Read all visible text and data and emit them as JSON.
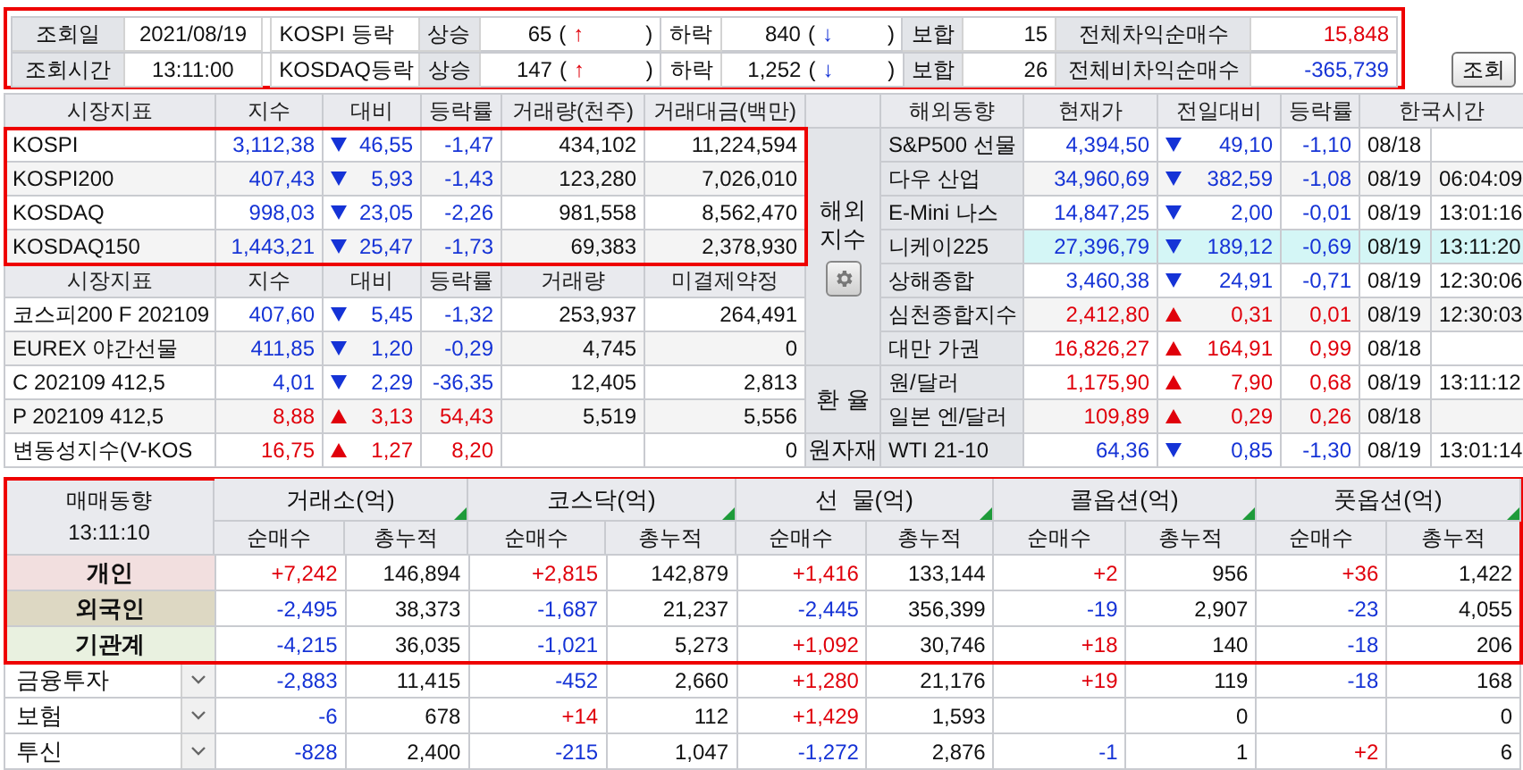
{
  "summary": {
    "highlighted": true,
    "info": [
      {
        "label": "조회일",
        "value": "2021/08/19"
      },
      {
        "label": "조회시간",
        "value": "13:11:00"
      }
    ],
    "markets": [
      {
        "name": "KOSPI 등락",
        "up_label": "상승",
        "up_count": "65",
        "up_open": "(",
        "up_arrow": "↑",
        "up_close": ")",
        "down_label": "하락",
        "down_count": "840",
        "down_open": "(",
        "down_arrow": "↓",
        "down_close": ")",
        "flat_label": "보합",
        "flat_count": "15",
        "program_label": "전체차익순매수",
        "program_value": "15,848",
        "program_rising": true
      },
      {
        "name": "KOSDAQ등락",
        "up_label": "상승",
        "up_count": "147",
        "up_open": "(",
        "up_arrow": "↑",
        "up_close": ")",
        "down_label": "하락",
        "down_count": "1,252",
        "down_open": "(",
        "down_arrow": "↓",
        "down_close": ")",
        "flat_label": "보합",
        "flat_count": "26",
        "program_label": "전체비차익순매수",
        "program_value": "-365,739",
        "program_rising": false
      }
    ]
  },
  "query_button": "조회",
  "domestic_indices": {
    "highlighted": true,
    "columns": [
      "시장지표",
      "지수",
      "대비",
      "등락률",
      "거래량(천주)",
      "거래대금(백만)"
    ],
    "rows": [
      {
        "name": "KOSPI",
        "index": "3,112,38",
        "rising": false,
        "change": "46,55",
        "rate": "-1,47",
        "volume": "434,102",
        "amount": "11,224,594"
      },
      {
        "name": "KOSPI200",
        "index": "407,43",
        "rising": false,
        "change": "5,93",
        "rate": "-1,43",
        "volume": "123,280",
        "amount": "7,026,010"
      },
      {
        "name": "KOSDAQ",
        "index": "998,03",
        "rising": false,
        "change": "23,05",
        "rate": "-2,26",
        "volume": "981,558",
        "amount": "8,562,470"
      },
      {
        "name": "KOSDAQ150",
        "index": "1,443,21",
        "rising": false,
        "change": "25,47",
        "rate": "-1,73",
        "volume": "69,383",
        "amount": "2,378,930"
      }
    ]
  },
  "derivatives": {
    "columns": [
      "시장지표",
      "지수",
      "대비",
      "등락률",
      "거래량",
      "미결제약정"
    ],
    "rows": [
      {
        "name": "코스피200 F 202109",
        "index": "407,60",
        "rising": false,
        "change": "5,45",
        "rate": "-1,32",
        "volume": "253,937",
        "amount": "264,491"
      },
      {
        "name": "EUREX 야간선물",
        "index": "411,85",
        "rising": false,
        "change": "1,20",
        "rate": "-0,29",
        "volume": "4,745",
        "amount": "0"
      },
      {
        "name": "C 202109 412,5",
        "index": "4,01",
        "rising": false,
        "change": "2,29",
        "rate": "-36,35",
        "volume": "12,405",
        "amount": "2,813"
      },
      {
        "name": "P 202109 412,5",
        "index": "8,88",
        "rising": true,
        "change": "3,13",
        "rate": "54,43",
        "volume": "5,519",
        "amount": "5,556"
      },
      {
        "name": "변동성지수(V-KOS",
        "index": "16,75",
        "rising": true,
        "change": "1,27",
        "rate": "8,20",
        "amount": "0"
      }
    ]
  },
  "overseas": {
    "columns": [
      "해외동향",
      "현재가",
      "전일대비",
      "등락률",
      "한국시간"
    ],
    "groups": [
      {
        "label": "해외지수",
        "has_settings": true,
        "rows": [
          {
            "name": "S&P500 선물",
            "price": "4,394,50",
            "rising": false,
            "change": "49,10",
            "rate": "-1,10",
            "date": "08/18",
            "selected": false
          },
          {
            "name": "다우 산업",
            "price": "34,960,69",
            "rising": false,
            "change": "382,59",
            "rate": "-1,08",
            "date": "08/19",
            "time": "06:04:09",
            "selected": false
          },
          {
            "name": "E-Mini 나스",
            "price": "14,847,25",
            "rising": false,
            "change": "2,00",
            "rate": "-0,01",
            "date": "08/19",
            "time": "13:01:16",
            "selected": false
          },
          {
            "name": "니케이225",
            "price": "27,396,79",
            "rising": false,
            "change": "189,12",
            "rate": "-0,69",
            "date": "08/19",
            "time": "13:11:20",
            "selected": true
          },
          {
            "name": "상해종합",
            "price": "3,460,38",
            "rising": false,
            "change": "24,91",
            "rate": "-0,71",
            "date": "08/19",
            "time": "12:30:06",
            "selected": false
          },
          {
            "name": "심천종합지수",
            "price": "2,412,80",
            "rising": true,
            "change": "0,31",
            "rate": "0,01",
            "date": "08/19",
            "time": "12:30:03",
            "selected": false
          },
          {
            "name": "대만 가권",
            "price": "16,826,27",
            "rising": true,
            "change": "164,91",
            "rate": "0,99",
            "date": "08/18",
            "selected": false
          }
        ]
      },
      {
        "label": "환 율",
        "has_settings": false,
        "rows": [
          {
            "name": "원/달러",
            "price": "1,175,90",
            "rising": true,
            "change": "7,90",
            "rate": "0,68",
            "date": "08/19",
            "time": "13:11:12",
            "selected": false
          },
          {
            "name": "일본 엔/달러",
            "price": "109,89",
            "rising": true,
            "change": "0,29",
            "rate": "0,26",
            "date": "08/18",
            "selected": false
          }
        ]
      },
      {
        "label": "원자재",
        "has_settings": false,
        "rows": [
          {
            "name": "WTI 21-10",
            "price": "64,36",
            "rising": false,
            "change": "0,85",
            "rate": "-1,30",
            "date": "08/19",
            "time": "13:01:14",
            "selected": false
          }
        ]
      }
    ]
  },
  "trading": {
    "highlighted": true,
    "title": "매매동향",
    "time": "13:11:10",
    "groups": [
      "거래소(억)",
      "코스닥(억)",
      "선  물(억)",
      "콜옵션(억)",
      "풋옵션(억)"
    ],
    "subcolumns": [
      "순매수",
      "총누적",
      "순매수",
      "총누적",
      "순매수",
      "총누적",
      "순매수",
      "총누적",
      "순매수",
      "총누적"
    ],
    "rows": [
      {
        "label": "개인",
        "kind": "investor",
        "color": "#f2dfdf",
        "cells": [
          {
            "net": "+7,242",
            "rising": true,
            "total": "146,894"
          },
          {
            "net": "+2,815",
            "rising": true,
            "total": "142,879"
          },
          {
            "net": "+1,416",
            "rising": true,
            "total": "133,144"
          },
          {
            "net": "+2",
            "rising": true,
            "total": "956"
          },
          {
            "net": "+36",
            "rising": true,
            "total": "1,422"
          }
        ]
      },
      {
        "label": "외국인",
        "kind": "investor",
        "color": "#ddd8c3",
        "cells": [
          {
            "net": "-2,495",
            "rising": false,
            "total": "38,373"
          },
          {
            "net": "-1,687",
            "rising": false,
            "total": "21,237"
          },
          {
            "net": "-2,445",
            "rising": false,
            "total": "356,399"
          },
          {
            "net": "-19",
            "rising": false,
            "total": "2,907"
          },
          {
            "net": "-23",
            "rising": false,
            "total": "4,055"
          }
        ]
      },
      {
        "label": "기관계",
        "kind": "investor",
        "color": "#e9f1e0",
        "cells": [
          {
            "net": "-4,215",
            "rising": false,
            "total": "36,035"
          },
          {
            "net": "-1,021",
            "rising": false,
            "total": "5,273"
          },
          {
            "net": "+1,092",
            "rising": true,
            "total": "30,746"
          },
          {
            "net": "+18",
            "rising": true,
            "total": "140"
          },
          {
            "net": "-18",
            "rising": false,
            "total": "206"
          }
        ]
      },
      {
        "label": "금융투자",
        "kind": "dropdown",
        "cells": [
          {
            "net": "-2,883",
            "rising": false,
            "total": "11,415"
          },
          {
            "net": "-452",
            "rising": false,
            "total": "2,660"
          },
          {
            "net": "+1,280",
            "rising": true,
            "total": "21,176"
          },
          {
            "net": "+19",
            "rising": true,
            "total": "119"
          },
          {
            "net": "-18",
            "rising": false,
            "total": "168"
          }
        ]
      },
      {
        "label": "보험",
        "kind": "dropdown",
        "cells": [
          {
            "net": "-6",
            "rising": false,
            "total": "678"
          },
          {
            "net": "+14",
            "rising": true,
            "total": "112"
          },
          {
            "net": "+1,429",
            "rising": true,
            "total": "1,593"
          },
          {
            "total": "0"
          },
          {
            "total": "0"
          }
        ]
      },
      {
        "label": "투신",
        "kind": "dropdown",
        "cells": [
          {
            "net": "-828",
            "rising": false,
            "total": "2,400"
          },
          {
            "net": "-215",
            "rising": false,
            "total": "1,047"
          },
          {
            "net": "-1,272",
            "rising": false,
            "total": "2,876"
          },
          {
            "net": "-1",
            "rising": false,
            "total": "1"
          },
          {
            "net": "+2",
            "rising": true,
            "total": "6"
          }
        ]
      }
    ]
  }
}
